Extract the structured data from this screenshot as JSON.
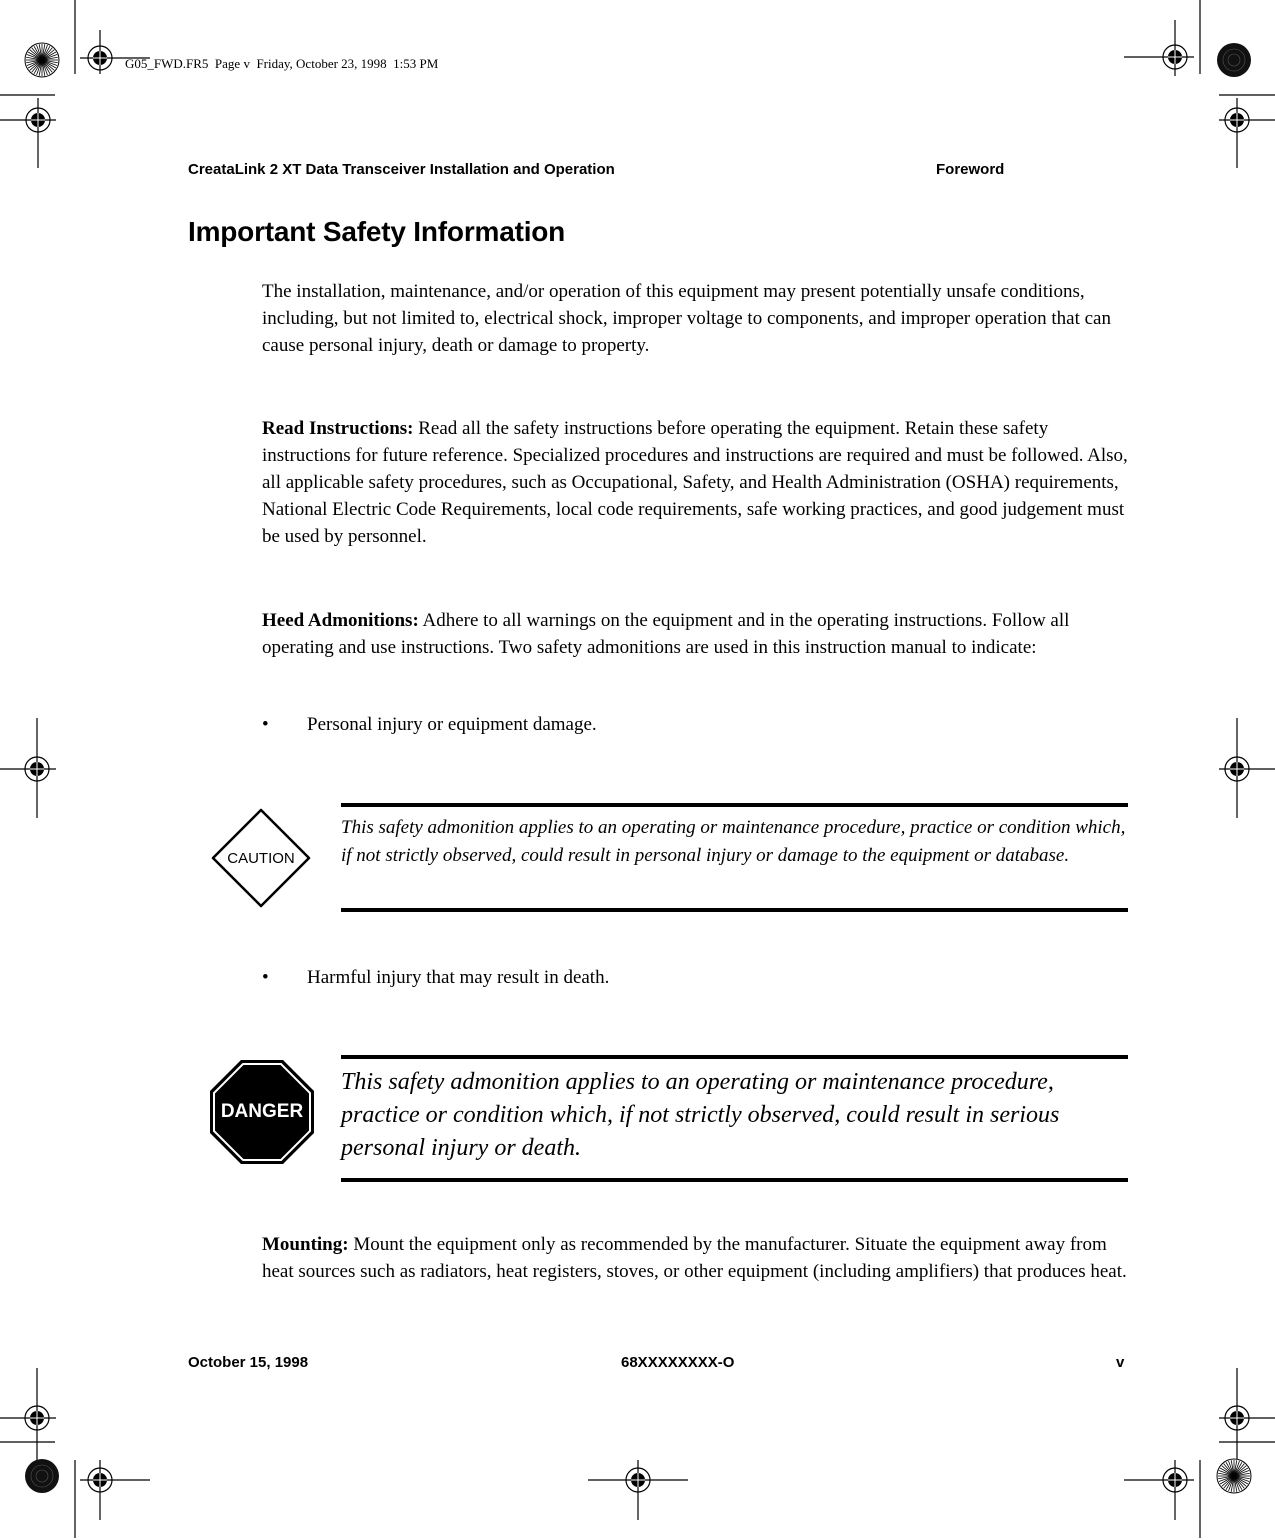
{
  "slug": "G05_FWD.FR5  Page v  Friday, October 23, 1998  1:53 PM",
  "running_header": {
    "title": "CreataLink 2 XT Data Transceiver Installation and Operation",
    "section": "Foreword"
  },
  "heading": "Important Safety Information",
  "intro": "The installation, maintenance, and/or operation of this equipment may present potentially unsafe conditions, including, but not limited to, electrical shock, improper voltage to components, and improper operation that can cause personal injury, death or damage to property.",
  "read_instructions": {
    "label": "Read Instructions:",
    "text": " Read all the safety instructions before operating the equipment. Retain these safety instructions for future reference. Specialized procedures and instructions are required and must be followed. Also, all applicable safety procedures, such as Occupational, Safety, and Health Administration (OSHA) requirements, National Electric Code Requirements, local code requirements, safe working practices, and good judgement must be used by personnel."
  },
  "heed_admonitions": {
    "label": "Heed Admonitions:",
    "text": " Adhere to all warnings on the equipment and in the operating instructions. Follow all operating and use instructions. Two safety admonitions are used in this instruction manual to indicate:"
  },
  "bullets": [
    {
      "symbol": "•",
      "text": "Personal injury or equipment damage."
    },
    {
      "symbol": "•",
      "text": "Harmful injury that may result in death."
    }
  ],
  "caution": {
    "icon": "caution-diamond-icon",
    "icon_label": "CAUTION",
    "text": "This safety admonition applies to an operating or maintenance procedure, practice or condition which, if not strictly observed, could result in personal injury or damage to the equipment or database."
  },
  "danger": {
    "icon": "danger-octagon-icon",
    "icon_label": "DANGER",
    "text": "This safety admonition applies to an operating or maintenance procedure, practice or condition which, if not strictly observed, could result in serious personal injury or death."
  },
  "mounting": {
    "label": "Mounting:",
    "text": " Mount the equipment only as recommended by the manufacturer. Situate the equipment away from heat sources such as radiators, heat registers, stoves, or other equipment (including amplifiers) that produces heat."
  },
  "footer": {
    "date": "October 15, 1998",
    "doc_number": "68XXXXXXXX-O",
    "page": "v"
  }
}
